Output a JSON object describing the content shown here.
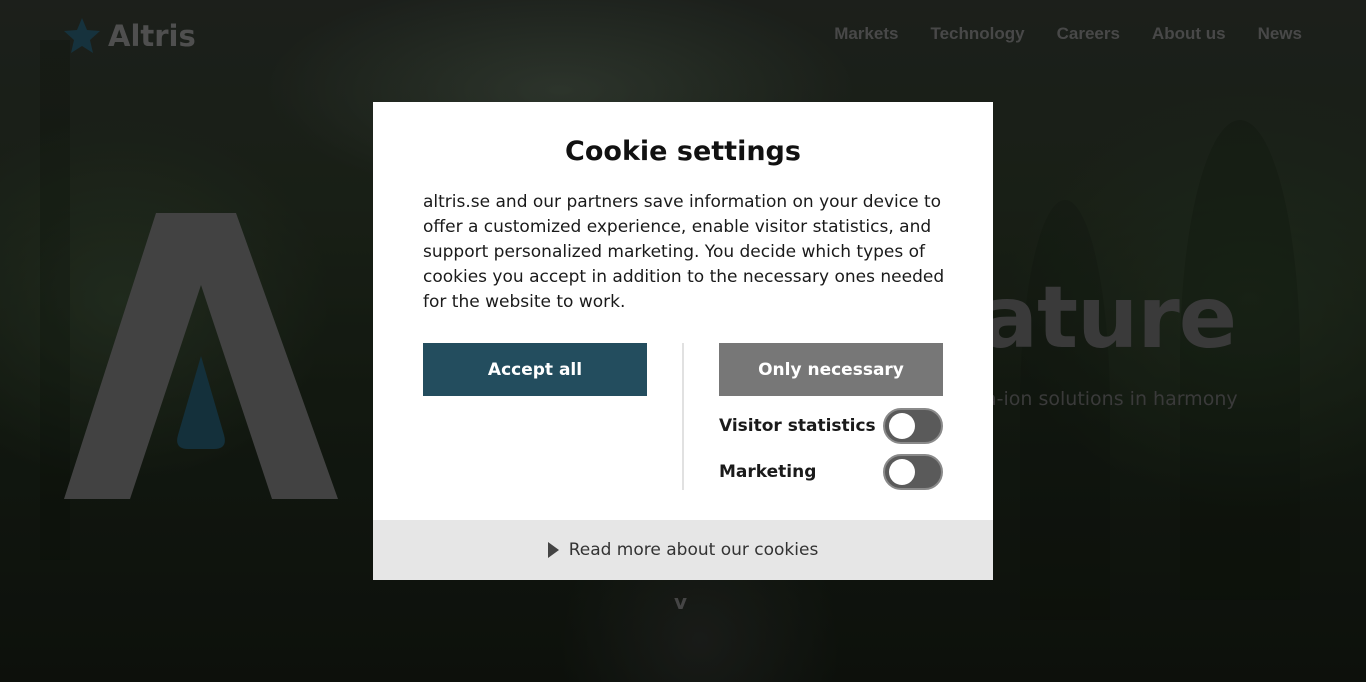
{
  "header": {
    "logo_text": "Altris",
    "nav": [
      "Markets",
      "Technology",
      "Careers",
      "About us",
      "News"
    ]
  },
  "hero": {
    "heading_visible": "ature",
    "subtitle_visible": "a-ion solutions in harmony",
    "scroll_glyph": "v"
  },
  "cookie_modal": {
    "title": "Cookie settings",
    "description": "altris.se and our partners save information on your device to offer a customized experience, enable visitor statistics, and support personalized marketing. You decide which types of cookies you accept in addition to the necessary ones needed for the website to work.",
    "accept_all_label": "Accept all",
    "only_necessary_label": "Only necessary",
    "toggles": [
      {
        "label": "Visitor statistics",
        "on": false
      },
      {
        "label": "Marketing",
        "on": false
      }
    ],
    "read_more_label": "Read more about our cookies"
  },
  "colors": {
    "accent": "#234d5e",
    "secondary_button": "#777777",
    "footer_bg": "#e6e6e6"
  },
  "icons": {
    "logo": "star-burst-logo-icon",
    "read_more": "triangle-right-icon"
  }
}
